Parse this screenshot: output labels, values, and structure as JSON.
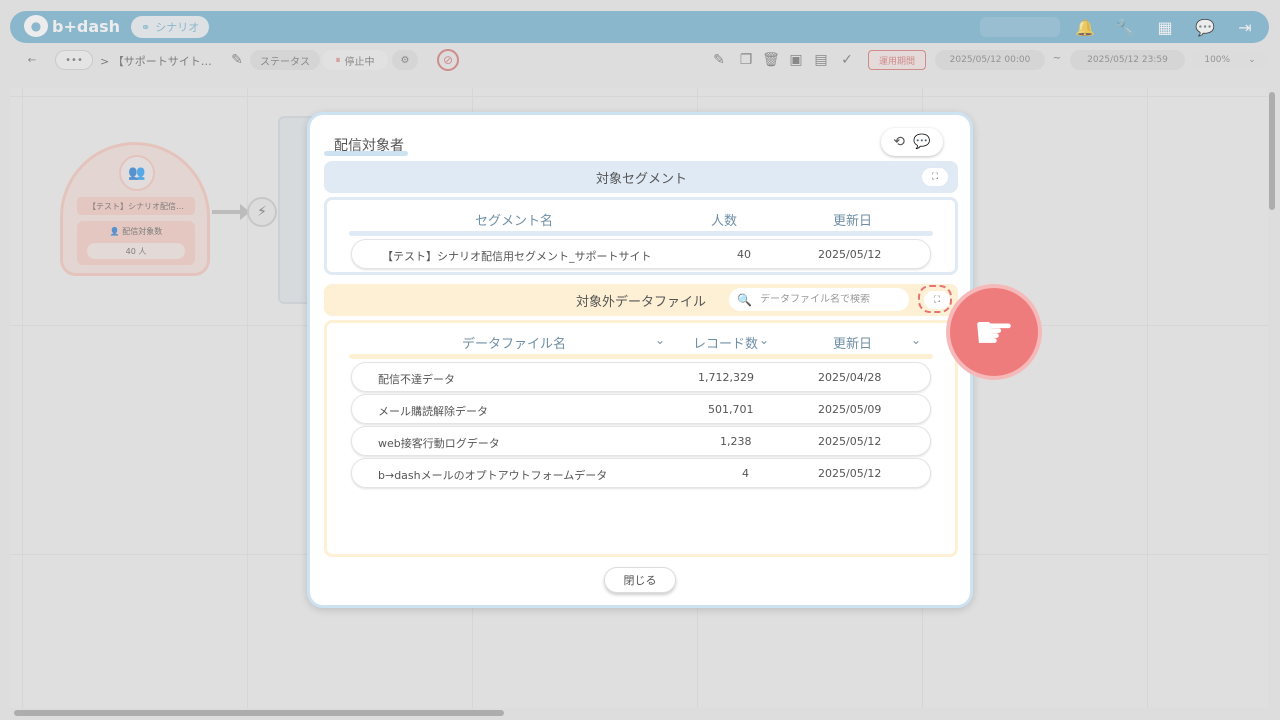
{
  "header": {
    "logo_text": "b+dash",
    "scenario_label": "シナリオ",
    "icons": [
      "bell-icon",
      "wrench-icon",
      "apps-grid-icon",
      "chat-bot-icon",
      "logout-icon"
    ]
  },
  "toolbar": {
    "back_glyph": "←",
    "more_glyph": "•••",
    "breadcrumb_sep": ">",
    "breadcrumb_text": "【サポートサイト…",
    "status_label": "ステータス",
    "status_value": "停止中",
    "period_label": "運用期間",
    "start_date": "2025/05/12 00:00",
    "tilde": "~",
    "end_date": "2025/05/12 23:59",
    "zoom": "100%"
  },
  "canvas": {
    "node_title": "【テスト】シナリオ配信…",
    "node_count_label": "配信対象数",
    "node_count": "40 人"
  },
  "modal": {
    "title": "配信対象者",
    "segment_section": {
      "title": "対象セグメント",
      "columns": [
        "セグメント名",
        "人数",
        "更新日"
      ],
      "rows": [
        {
          "name": "【テスト】シナリオ配信用セグメント_サポートサイト",
          "count": "40",
          "date": "2025/05/12"
        }
      ]
    },
    "exclude_section": {
      "title": "対象外データファイル",
      "search_placeholder": "データファイル名で検索",
      "columns": [
        "データファイル名",
        "レコード数",
        "更新日"
      ],
      "rows": [
        {
          "name": "配信不達データ",
          "count": "1,712,329",
          "date": "2025/04/28"
        },
        {
          "name": "メール購読解除データ",
          "count": "501,701",
          "date": "2025/05/09"
        },
        {
          "name": "web接客行動ログデータ",
          "count": "1,238",
          "date": "2025/05/12"
        },
        {
          "name": "b→dashメールのオプトアウトフォームデータ",
          "count": "4",
          "date": "2025/05/12"
        }
      ]
    },
    "close_label": "閉じる"
  },
  "colors": {
    "header_blue": "#6aaed0",
    "segment_accent": "#dfeaf4",
    "exclude_accent": "#fdf0d5",
    "pointer_red": "#ef7c7c"
  }
}
